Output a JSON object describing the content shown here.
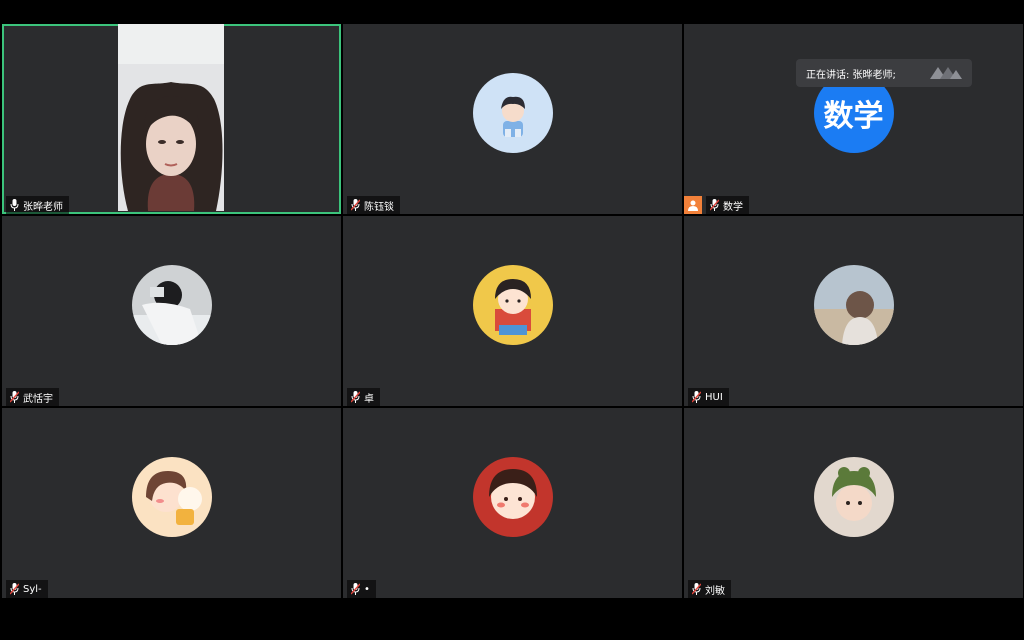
{
  "speaking": {
    "label": "正在讲话: 张晔老师;"
  },
  "tiles": [
    {
      "name": "张晔老师",
      "type": "video",
      "active": true
    },
    {
      "name": "陈钰锬",
      "type": "avatar"
    },
    {
      "name": "数学",
      "type": "text-avatar",
      "avatar_text": "数学",
      "host": true
    },
    {
      "name": "武恬宇",
      "type": "avatar"
    },
    {
      "name": "卓",
      "type": "avatar"
    },
    {
      "name": "HUI",
      "type": "avatar"
    },
    {
      "name": "Syl-",
      "type": "avatar"
    },
    {
      "name": "•",
      "type": "avatar"
    },
    {
      "name": "刘敏",
      "type": "avatar"
    }
  ],
  "colors": {
    "active_border": "#3cc47c",
    "tile_bg": "#2b2c2e",
    "text_avatar_bg": "#1b7cf3",
    "host_badge": "#f2813a",
    "muted_mic": "#e0443b"
  }
}
